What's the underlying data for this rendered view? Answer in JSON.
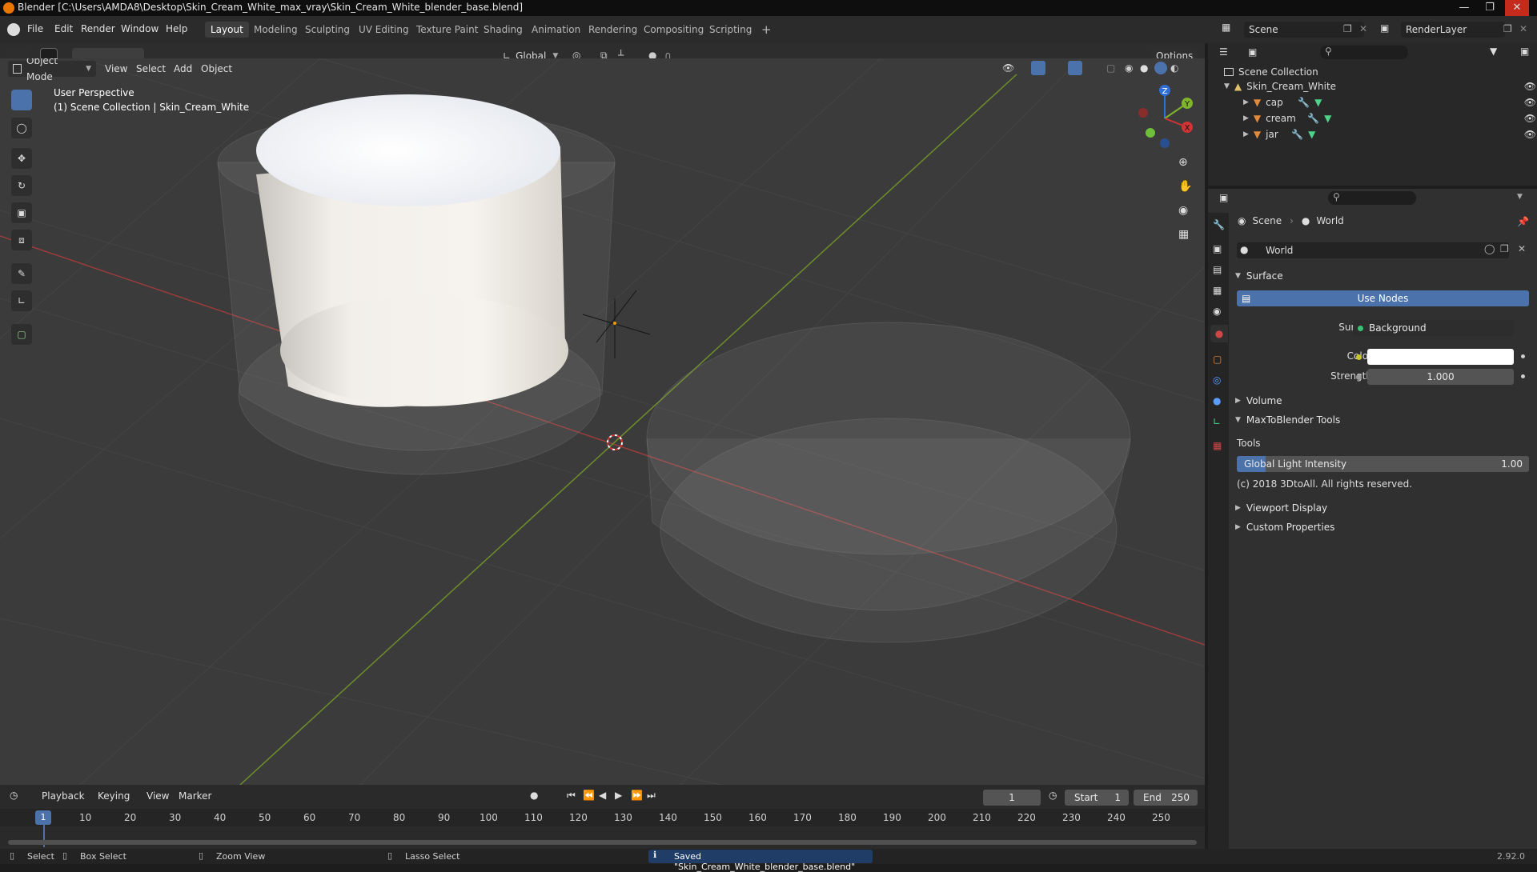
{
  "window": {
    "title": "Blender [C:\\Users\\AMDA8\\Desktop\\Skin_Cream_White_max_vray\\Skin_Cream_White_blender_base.blend]"
  },
  "menu": [
    "File",
    "Edit",
    "Render",
    "Window",
    "Help"
  ],
  "workspaces": [
    "Layout",
    "Modeling",
    "Sculpting",
    "UV Editing",
    "Texture Paint",
    "Shading",
    "Animation",
    "Rendering",
    "Compositing",
    "Scripting"
  ],
  "top_right": {
    "scene": "Scene",
    "render_layer": "RenderLayer"
  },
  "viewport": {
    "transform": "Global",
    "options": "Options",
    "mode": "Object Mode",
    "menus": [
      "View",
      "Select",
      "Add",
      "Object"
    ],
    "overlay_line1": "User Perspective",
    "overlay_line2": "(1) Scene Collection | Skin_Cream_White",
    "gizmo": {
      "x": "X",
      "y": "Y",
      "z": "Z"
    }
  },
  "outliner": {
    "root": "Scene Collection",
    "collection": "Skin_Cream_White",
    "items": [
      "cap",
      "cream",
      "jar"
    ]
  },
  "properties": {
    "breadcrumb_scene": "Scene",
    "breadcrumb_world": "World",
    "world_name": "World",
    "surface_panel": "Surface",
    "use_nodes": "Use Nodes",
    "surface_label": "Surface",
    "surface_value": "Background",
    "color_label": "Color",
    "color_value": "#ffffff",
    "strength_label": "Strength",
    "strength_value": "1.000",
    "volume_panel": "Volume",
    "maxtoblender_panel": "MaxToBlender Tools",
    "tools_label": "Tools",
    "gli_label": "Global Light Intensity",
    "gli_value": "1.00",
    "copyright": "(c) 2018 3DtoAll. All rights reserved.",
    "viewport_display": "Viewport Display",
    "custom_properties": "Custom Properties"
  },
  "timeline": {
    "menus": [
      "Playback",
      "Keying",
      "View",
      "Marker"
    ],
    "current_frame": "1",
    "start_label": "Start",
    "start": "1",
    "end_label": "End",
    "end": "250",
    "ticks": [
      "10",
      "20",
      "30",
      "40",
      "50",
      "60",
      "70",
      "80",
      "90",
      "100",
      "110",
      "120",
      "130",
      "140",
      "150",
      "160",
      "170",
      "180",
      "190",
      "200",
      "210",
      "220",
      "230",
      "240",
      "250"
    ],
    "marker": "1"
  },
  "status": {
    "select": "Select",
    "box_select": "Box Select",
    "zoom_view": "Zoom View",
    "lasso_select": "Lasso Select",
    "message": "Saved \"Skin_Cream_White_blender_base.blend\"",
    "version": "2.92.0"
  }
}
